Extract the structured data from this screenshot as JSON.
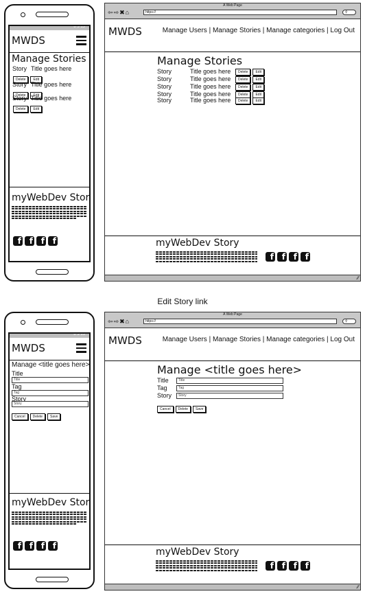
{
  "phone_status": "8 3 13",
  "browser": {
    "window_title": "A Web Page",
    "url": "https://"
  },
  "brand": "MWDS",
  "nav": [
    "Manage Users",
    "Manage Stories",
    "Manage categories",
    "Log Out"
  ],
  "nav_separator": "|",
  "list_screen": {
    "title": "Manage Stories",
    "rows": [
      {
        "label": "Story",
        "title": "Title goes here"
      },
      {
        "label": "Story",
        "title": "Title goes here"
      },
      {
        "label": "Story",
        "title": "Title goes here"
      },
      {
        "label": "Story",
        "title": "Title goes here"
      },
      {
        "label": "Story",
        "title": "Title goes here"
      }
    ],
    "delete_label": "Delete",
    "edit_label": "Edit"
  },
  "caption": "Edit Story link",
  "edit_screen": {
    "title": "Manage <title goes here>",
    "fields": [
      {
        "label": "Title",
        "placeholder": "Title"
      },
      {
        "label": "Tag",
        "placeholder": "Tag"
      },
      {
        "label": "Story",
        "placeholder": "Story"
      }
    ],
    "buttons": [
      "Cancel",
      "Delete",
      "Save"
    ]
  },
  "footer": {
    "title": "myWebDev Story",
    "social_glyph": "f"
  },
  "icons": {
    "nav_back": "arrow-left",
    "nav_forward": "arrow-right",
    "nav_stop": "close",
    "nav_home": "home",
    "search": "search",
    "menu": "hamburger",
    "social": "facebook",
    "resize": "resize-grip"
  }
}
